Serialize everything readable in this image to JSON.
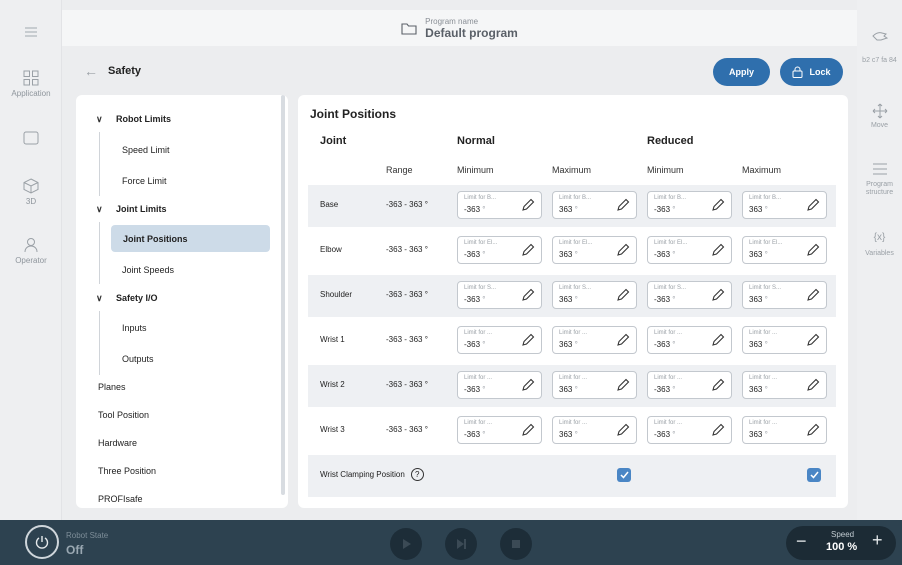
{
  "left_nav": {
    "items": [
      {
        "label": "",
        "icon": "menu-icon"
      },
      {
        "label": "Application",
        "icon": "grid-icon"
      },
      {
        "label": "",
        "icon": "panel-icon"
      },
      {
        "label": "3D",
        "icon": "cube-icon"
      },
      {
        "label": "Operator",
        "icon": "person-icon"
      }
    ]
  },
  "topbar": {
    "program_label": "Program name",
    "program_name": "Default program",
    "icon": "folder-icon"
  },
  "header": {
    "title": "Safety",
    "apply_label": "Apply",
    "lock_label": "Lock"
  },
  "tree": {
    "robot_limits": "Robot Limits",
    "speed_limit": "Speed Limit",
    "force_limit": "Force Limit",
    "joint_limits": "Joint Limits",
    "joint_positions": "Joint Positions",
    "joint_speeds": "Joint Speeds",
    "safety_io": "Safety I/O",
    "inputs": "Inputs",
    "outputs": "Outputs",
    "planes": "Planes",
    "tool_position": "Tool Position",
    "hardware": "Hardware",
    "three_position": "Three Position",
    "profisafe": "PROFIsafe"
  },
  "main": {
    "title": "Joint Positions",
    "col_joint": "Joint",
    "col_normal": "Normal",
    "col_reduced": "Reduced",
    "sub_range": "Range",
    "sub_min": "Minimum",
    "sub_max": "Maximum",
    "unit": "°",
    "rows": [
      {
        "name": "Base",
        "range": "-363 - 363 °",
        "ph": "Limit for B...",
        "min": "-363",
        "max": "363"
      },
      {
        "name": "Elbow",
        "range": "-363 - 363 °",
        "ph": "Limit for El...",
        "min": "-363",
        "max": "363"
      },
      {
        "name": "Shoulder",
        "range": "-363 - 363 °",
        "ph": "Limit for S...",
        "min": "-363",
        "max": "363"
      },
      {
        "name": "Wrist 1",
        "range": "-363 - 363 °",
        "ph": "Limit for ...",
        "min": "-363",
        "max": "363"
      },
      {
        "name": "Wrist 2",
        "range": "-363 - 363 °",
        "ph": "Limit for ...",
        "min": "-363",
        "max": "363"
      },
      {
        "name": "Wrist 3",
        "range": "-363 - 363 °",
        "ph": "Limit for ...",
        "min": "-363",
        "max": "363"
      }
    ],
    "clamping_label": "Wrist Clamping Position",
    "clamping_help": "?",
    "clamping_normal": true,
    "clamping_reduced": true
  },
  "right_nav": {
    "items": [
      {
        "label": "",
        "icon": "hand-icon"
      },
      {
        "label": "b2 c7 fa 84"
      },
      {
        "label": "Move",
        "icon": "move-icon"
      },
      {
        "label": "Program structure",
        "icon": "list-icon"
      },
      {
        "label": "Variables",
        "icon": "variable-icon"
      }
    ]
  },
  "bottom": {
    "robot_state_label": "Robot State",
    "robot_state_value": "Off",
    "speed_label": "Speed",
    "speed_value": "100 %"
  },
  "colors": {
    "accent": "#2f6fad",
    "bottom_bar": "#2d4250",
    "selected": "#cddbe8",
    "checkbox": "#4a86c5"
  }
}
